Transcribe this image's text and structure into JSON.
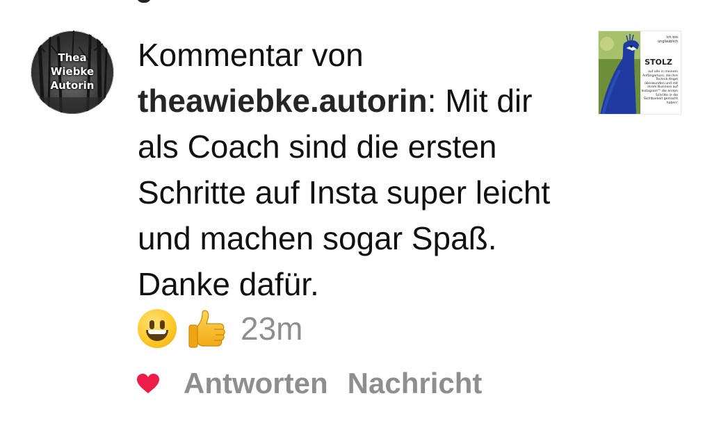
{
  "avatar": {
    "line1": "Thea",
    "line2": "Wiebke",
    "line3": "Autorin"
  },
  "comment": {
    "prefix": "Kommentar von",
    "username": "theawiebke.autorin",
    "text": ": Mit dir als Coach sind die ersten Schritte auf Insta super leicht und machen sogar Spaß. Danke dafür.",
    "emojis": [
      "grinning-face",
      "thumbs-up"
    ],
    "time": "23m"
  },
  "actions": {
    "reply_label": "Antworten",
    "message_label": "Nachricht",
    "heart_color": "#ed1c48"
  },
  "thumbnail": {
    "line1": "Ich bin",
    "line2": "unglaublich",
    "headline": "STOLZ",
    "body": "auf alle in meinem Anfängerkurs, die ihre Technik-Angst überwunden und mit ihrem Business auf Instagram™ die ersten Schritte in die Sichtbarkeit gemacht haben!"
  }
}
